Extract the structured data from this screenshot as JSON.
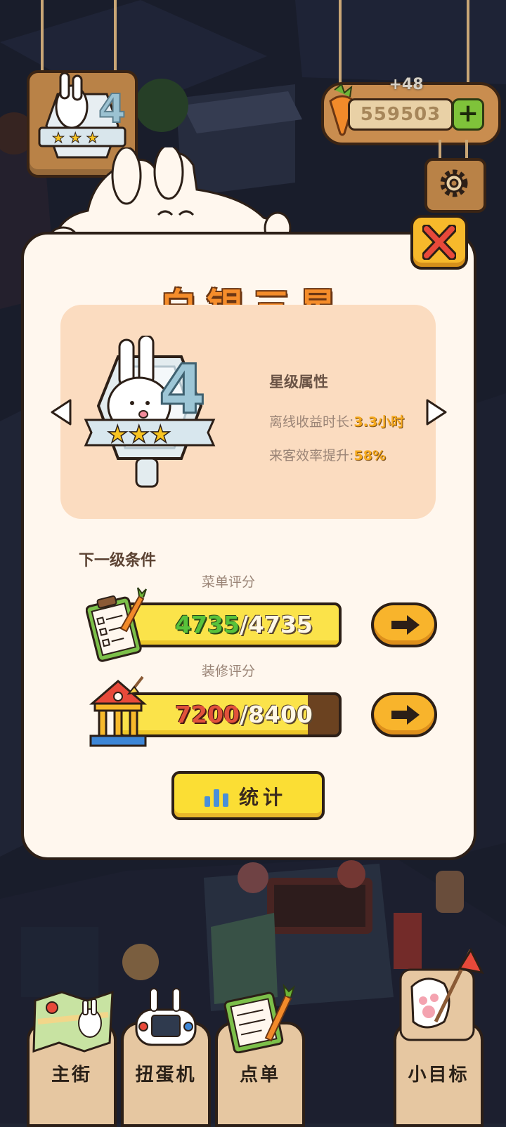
{
  "currency": {
    "amount": "559503",
    "gain_popup": "+48",
    "add_symbol": "+"
  },
  "modal": {
    "title": "白银三星",
    "attributes_title": "星级属性",
    "attributes": [
      {
        "label": "离线收益时长:",
        "value": "3.3小时"
      },
      {
        "label": "来客效率提升:",
        "value": "58%"
      }
    ],
    "next_level_title": "下一级条件",
    "requirements": [
      {
        "label": "菜单评分",
        "current": "4735",
        "separator": "/",
        "target": "4735",
        "progress": 1.0
      },
      {
        "label": "装修评分",
        "current": "7200",
        "separator": "/",
        "target": "8400",
        "progress": 0.857
      }
    ],
    "stats_button": "统计"
  },
  "bottom_nav": [
    {
      "label": "主街"
    },
    {
      "label": "扭蛋机"
    },
    {
      "label": "点单"
    },
    {
      "label": "小目标"
    }
  ],
  "colors": {
    "modal_bg": "#fff7ee",
    "title_orange": "#f58d2b",
    "bar_yellow": "#fbe34a",
    "accent_green": "#58c23b",
    "accent_red": "#e2523b"
  }
}
